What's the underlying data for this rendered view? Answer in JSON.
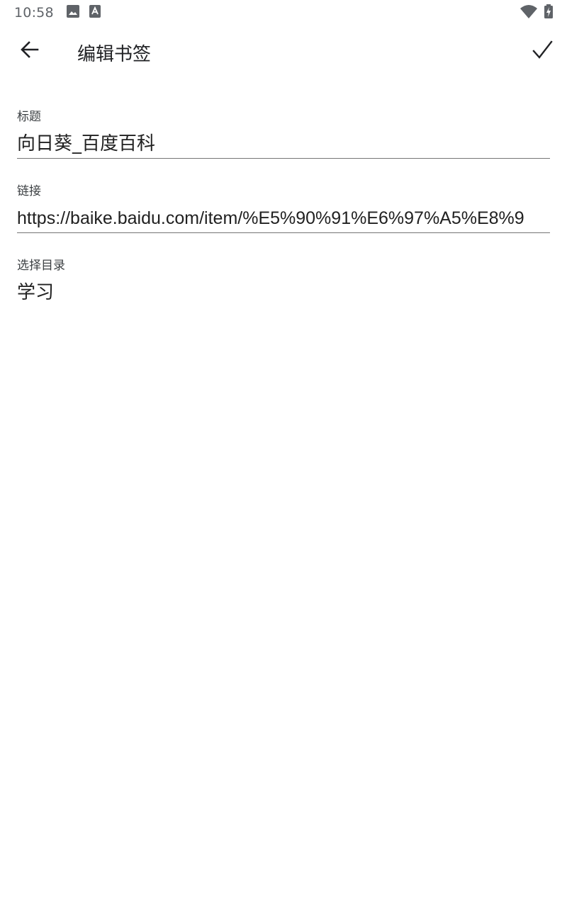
{
  "status_bar": {
    "time": "10:58",
    "icons_left": [
      "image-icon",
      "a-text-icon"
    ],
    "icons_right": [
      "wifi-icon",
      "battery-charging-icon"
    ]
  },
  "toolbar": {
    "title": "编辑书签",
    "back_icon": "arrow-left-icon",
    "confirm_icon": "check-icon"
  },
  "form": {
    "title_label": "标题",
    "title_value": "向日葵_百度百科",
    "link_label": "链接",
    "link_value": "https://baike.baidu.com/item/%E5%90%91%E6%97%A5%E8%9",
    "directory_label": "选择目录",
    "directory_value": "学习"
  },
  "colors": {
    "background": "#ffffff",
    "text_primary": "#212121",
    "underline": "#757575",
    "status_icon": "#5f6368"
  }
}
